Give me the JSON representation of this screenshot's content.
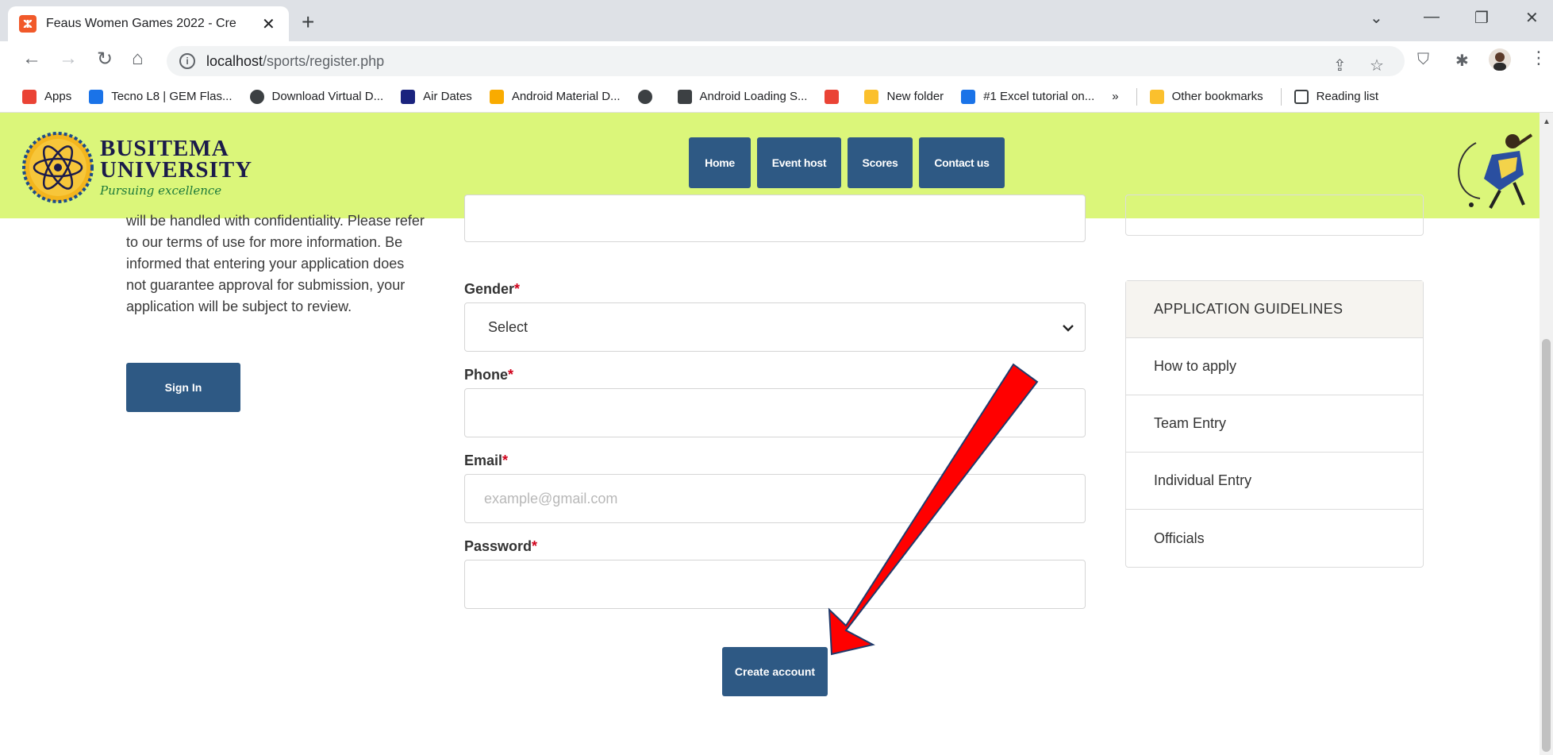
{
  "browser": {
    "tab_title": "Feaus Women Games 2022 - Cre",
    "tab_favicon": "xampp-icon",
    "url_host": "localhost",
    "url_path": "/sports/register.php",
    "bookmarks": [
      {
        "label": "Apps",
        "icon": "apps-grid-icon",
        "color": "#ea4335"
      },
      {
        "label": "Tecno L8 | GEM Flas...",
        "icon": "gem-icon",
        "color": "#1a73e8"
      },
      {
        "label": "Download Virtual D...",
        "icon": "globe-icon",
        "color": "#3c4043"
      },
      {
        "label": "Air Dates",
        "icon": "tv-icon",
        "color": "#1a237e"
      },
      {
        "label": "Android Material D...",
        "icon": "material-icon",
        "color": "#f9ab00"
      },
      {
        "label": "",
        "icon": "globe-icon",
        "color": "#3c4043"
      },
      {
        "label": "Android Loading S...",
        "icon": "diamond-icon",
        "color": "#3c4043"
      },
      {
        "label": "",
        "icon": "google-icon",
        "color": "#ea4335"
      },
      {
        "label": "New folder",
        "icon": "folder-icon",
        "color": "#fbc02d"
      },
      {
        "label": "#1 Excel tutorial on...",
        "icon": "excel-icon",
        "color": "#1a73e8"
      }
    ],
    "more_bookmarks": "»",
    "other_bookmarks": "Other bookmarks",
    "reading_list": "Reading list"
  },
  "site": {
    "logo_line1": "BUSITEMA",
    "logo_line2": "UNIVERSITY",
    "logo_tagline": "Pursuing excellence",
    "nav": [
      "Home",
      "Event host",
      "Scores",
      "Contact us"
    ],
    "accent": "#2e5984",
    "header_bg": "#dbf67a"
  },
  "left": {
    "notice": "will be handled with confidentiality. Please refer to our terms of use for more information. Be informed that entering your application does not guarantee approval for submission, your application will be subject to review.",
    "signin_label": "Sign In"
  },
  "form": {
    "gender_label": "Gender",
    "gender_value": "Select",
    "phone_label": "Phone",
    "email_label": "Email",
    "email_placeholder": "example@gmail.com",
    "password_label": "Password",
    "required_mark": "*",
    "create_label": "Create account"
  },
  "guidelines": {
    "title": "APPLICATION GUIDELINES",
    "items": [
      "How to apply",
      "Team Entry",
      "Individual Entry",
      "Officials"
    ]
  }
}
